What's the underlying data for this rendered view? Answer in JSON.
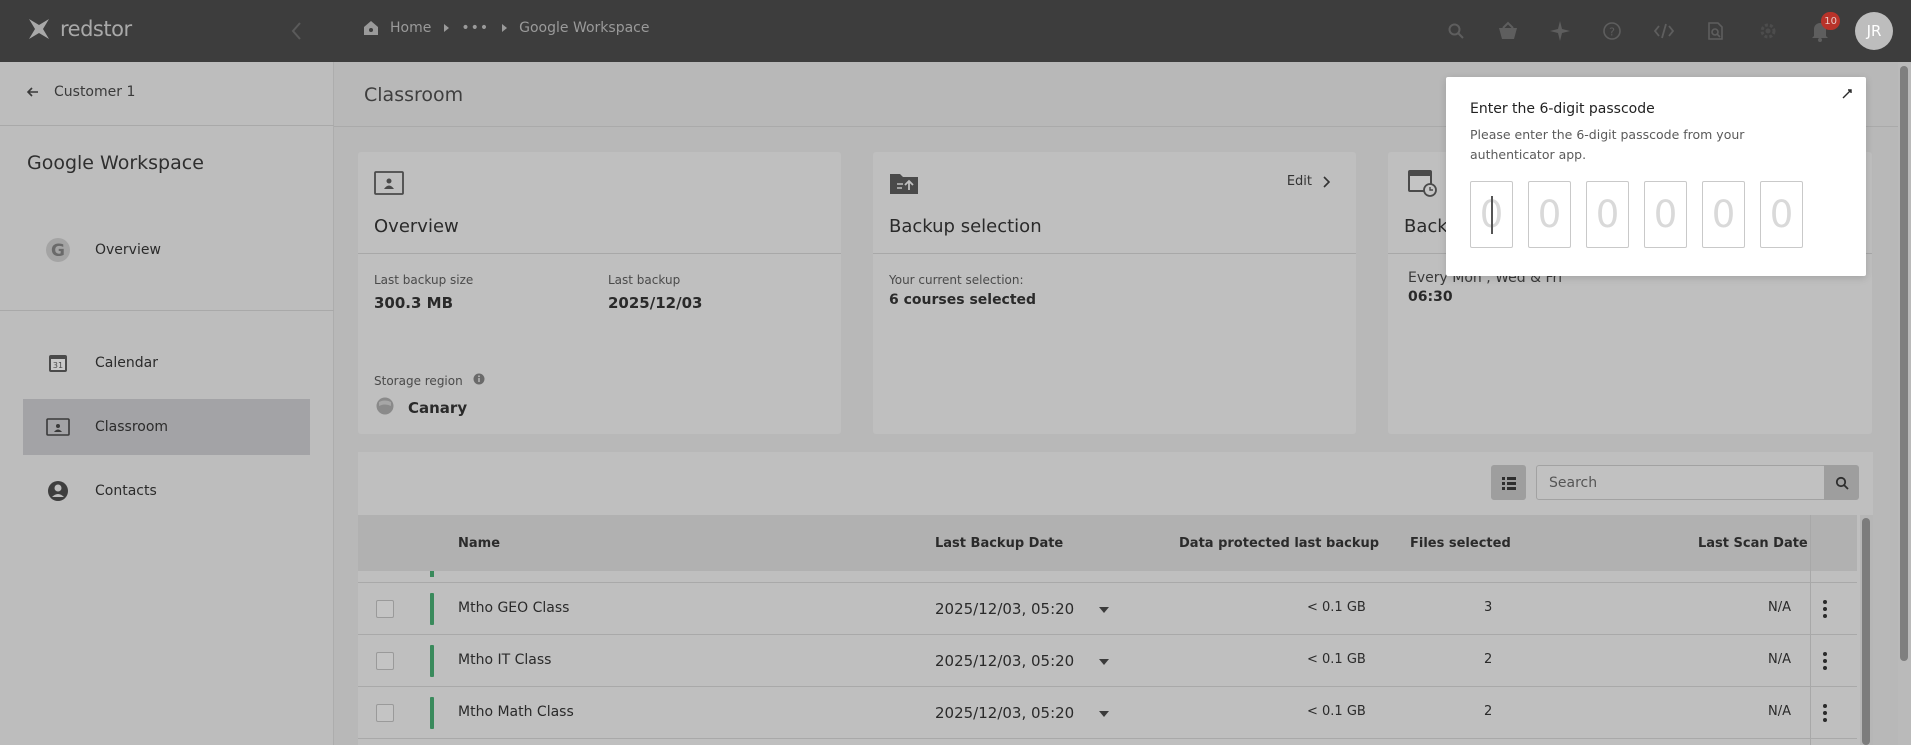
{
  "topbar": {
    "logo_text": "redstor",
    "breadcrumbs": {
      "home": "Home",
      "more": "•••",
      "current": "Google Workspace"
    },
    "icons": [
      "search-icon",
      "basket-icon",
      "sparkle-icon",
      "help-icon",
      "code-icon",
      "document-search-icon",
      "gear-icon",
      "bell-icon"
    ],
    "notification_count": "10",
    "avatar_initials": "JR"
  },
  "sidebar": {
    "back_label": "Customer 1",
    "title": "Google Workspace",
    "items": [
      {
        "label": "Overview",
        "icon": "google-icon"
      },
      {
        "label": "Calendar",
        "icon": "calendar-icon"
      },
      {
        "label": "Classroom",
        "icon": "classroom-icon",
        "active": true
      },
      {
        "label": "Contacts",
        "icon": "contacts-icon"
      }
    ]
  },
  "main": {
    "title": "Classroom",
    "overview_card": {
      "title": "Overview",
      "last_backup_size_label": "Last backup size",
      "last_backup_size": "300.3 MB",
      "last_backup_label": "Last backup",
      "last_backup": "2025/12/03",
      "storage_region_label": "Storage region",
      "storage_region": "Canary"
    },
    "backup_selection_card": {
      "title": "Backup selection",
      "edit_label": "Edit",
      "current_selection_label": "Your current selection:",
      "current_selection": "6 courses selected"
    },
    "schedule_card": {
      "title": "Back",
      "schedule_days": "Every Mon , Wed & Fri",
      "schedule_time": "06:30"
    }
  },
  "table": {
    "search_placeholder": "Search",
    "columns": {
      "name": "Name",
      "last_backup_date": "Last Backup Date",
      "data_protected": "Data protected last backup",
      "files_selected": "Files selected",
      "last_scan_date": "Last Scan Date"
    },
    "rows": [
      {
        "name": "Mtho GEO Class",
        "last_backup_date": "2025/12/03, 05:20",
        "data_protected": "< 0.1 GB",
        "files_selected": "3",
        "last_scan_date": "N/A"
      },
      {
        "name": "Mtho IT Class",
        "last_backup_date": "2025/12/03, 05:20",
        "data_protected": "< 0.1 GB",
        "files_selected": "2",
        "last_scan_date": "N/A"
      },
      {
        "name": "Mtho Math Class",
        "last_backup_date": "2025/12/03, 05:20",
        "data_protected": "< 0.1 GB",
        "files_selected": "2",
        "last_scan_date": "N/A"
      }
    ]
  },
  "modal": {
    "title": "Enter the 6-digit passcode",
    "description": "Please enter the 6-digit passcode from your authenticator app.",
    "digit_placeholders": [
      "0",
      "0",
      "0",
      "0",
      "0",
      "0"
    ]
  },
  "colors": {
    "topbar": "#3d3d3d",
    "status_green": "#3a8a5c",
    "badge_red": "#b8332a"
  }
}
